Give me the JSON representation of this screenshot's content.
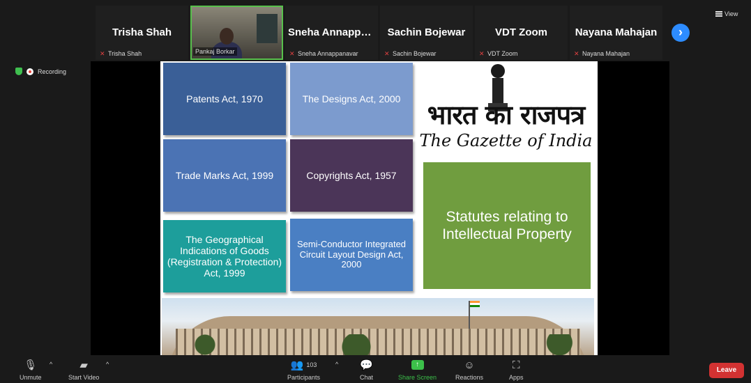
{
  "gallery": {
    "tiles": [
      {
        "name": "Trisha Shah",
        "label": "Trisha Shah"
      },
      {
        "name": "",
        "label": "Pankaj Borkar"
      },
      {
        "name": "Sneha Annappa...",
        "label": "Sneha Annappanavar"
      },
      {
        "name": "Sachin Bojewar",
        "label": "Sachin Bojewar"
      },
      {
        "name": "VDT Zoom",
        "label": "VDT Zoom"
      },
      {
        "name": "Nayana Mahajan",
        "label": "Nayana Mahajan"
      }
    ],
    "view_label": "View"
  },
  "status": {
    "recording_label": "Recording"
  },
  "slide": {
    "boxes": {
      "patents": "Patents Act, 1970",
      "designs": "The Designs Act, 2000",
      "trademarks": "Trade Marks Act, 1999",
      "copyrights": "Copyrights Act, 1957",
      "gi": "The Geographical Indications of Goods (Registration & Protection) Act, 1999",
      "semiconductor": "Semi-Conductor Integrated Circuit Layout Design Act, 2000",
      "statutes": "Statutes relating to Intellectual Property"
    },
    "hindi_title": "भारत का राजपत्र",
    "english_title": "The Gazette of India"
  },
  "toolbar": {
    "unmute": "Unmute",
    "start_video": "Start Video",
    "participants": "Participants",
    "participants_count": "103",
    "chat": "Chat",
    "share_screen": "Share Screen",
    "reactions": "Reactions",
    "apps": "Apps",
    "leave": "Leave"
  },
  "colors": {
    "accent": "#2d8cff",
    "share_green": "#3cc04a",
    "leave_red": "#d23232",
    "active_speaker_border": "#58c04c",
    "statutes_green": "#709d3f"
  }
}
